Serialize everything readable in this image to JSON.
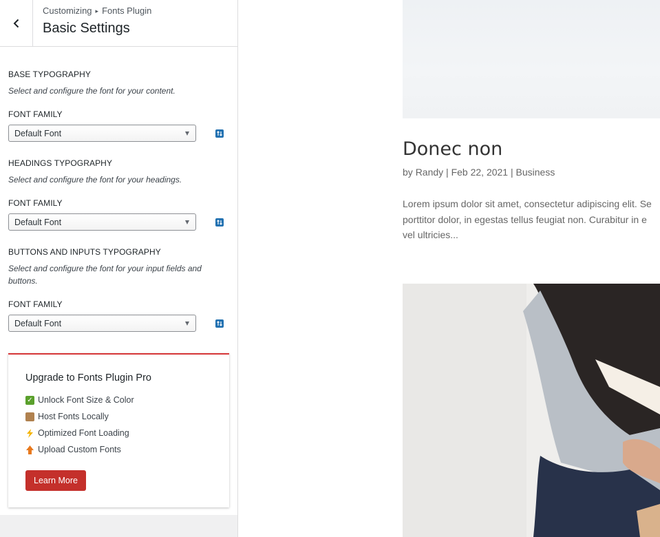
{
  "sidebar": {
    "breadcrumb": {
      "parent": "Customizing",
      "separator": "▸",
      "current": "Fonts Plugin"
    },
    "title": "Basic Settings",
    "sections": [
      {
        "heading": "Base Typography",
        "description": "Select and configure the font for your content.",
        "field_label": "Font Family",
        "selected": "Default Font"
      },
      {
        "heading": "Headings Typography",
        "description": "Select and configure the font for your headings.",
        "field_label": "Font Family",
        "selected": "Default Font"
      },
      {
        "heading": "Buttons and Inputs Typography",
        "description": "Select and configure the font for your input fields and buttons.",
        "field_label": "Font Family",
        "selected": "Default Font"
      }
    ],
    "promo": {
      "title": "Upgrade to Fonts Plugin Pro",
      "features": [
        {
          "icon": "check-mark-icon",
          "text": "Unlock Font Size & Color"
        },
        {
          "icon": "package-icon",
          "text": "Host Fonts Locally"
        },
        {
          "icon": "lightning-icon",
          "text": "Optimized Font Loading"
        },
        {
          "icon": "upload-icon",
          "text": "Upload Custom Fonts"
        }
      ],
      "button_label": "Learn More"
    }
  },
  "preview": {
    "post": {
      "title": "Donec non",
      "author_prefix": "by",
      "author": "Randy",
      "divider": "|",
      "date": "Feb 22, 2021",
      "category": "Business",
      "excerpt_lines": [
        "Lorem ipsum dolor sit amet, consectetur adipiscing elit. Se",
        "porttitor dolor, in egestas tellus feugiat non. Curabitur in e",
        "vel ultricies..."
      ]
    }
  },
  "colors": {
    "accent_blue": "#2271b1",
    "promo_red": "#c4302b",
    "promo_border": "#d63638"
  }
}
